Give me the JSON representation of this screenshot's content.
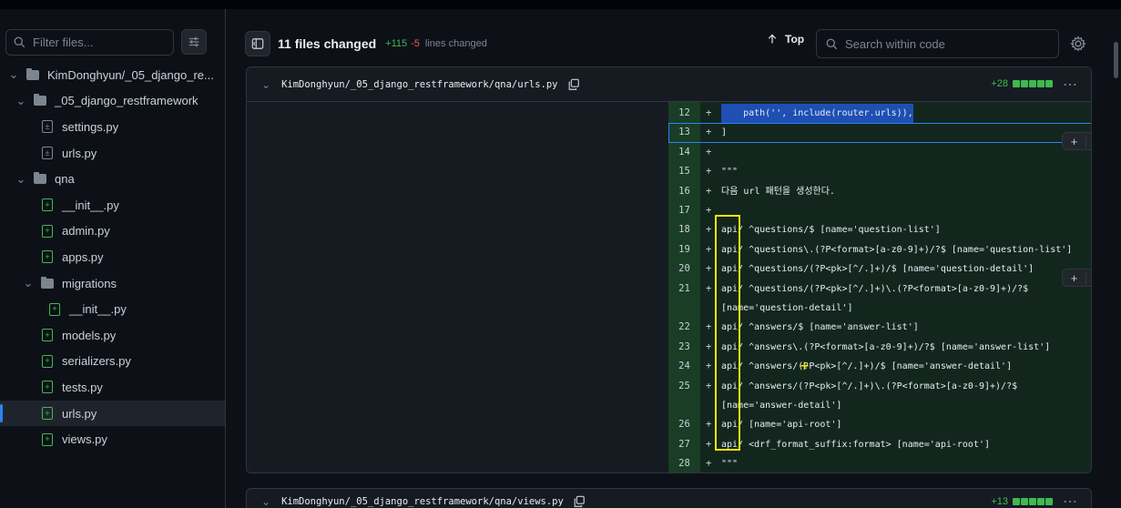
{
  "sidebar": {
    "filter_placeholder": "Filter files...",
    "tree": [
      {
        "label": "KimDonghyun/_05_django_re...",
        "type": "folder",
        "depth": 0
      },
      {
        "label": "_05_django_restframework",
        "type": "folder",
        "depth": 1
      },
      {
        "label": "settings.py",
        "type": "file-modified",
        "depth": 2
      },
      {
        "label": "urls.py",
        "type": "file-modified",
        "depth": 2
      },
      {
        "label": "qna",
        "type": "folder",
        "depth": 1
      },
      {
        "label": "__init__.py",
        "type": "file-added",
        "depth": 2
      },
      {
        "label": "admin.py",
        "type": "file-added",
        "depth": 2
      },
      {
        "label": "apps.py",
        "type": "file-added",
        "depth": 2
      },
      {
        "label": "migrations",
        "type": "folder",
        "depth": 2
      },
      {
        "label": "__init__.py",
        "type": "file-added",
        "depth": 3
      },
      {
        "label": "models.py",
        "type": "file-added",
        "depth": 2
      },
      {
        "label": "serializers.py",
        "type": "file-added",
        "depth": 2
      },
      {
        "label": "tests.py",
        "type": "file-added",
        "depth": 2
      },
      {
        "label": "urls.py",
        "type": "file-added",
        "depth": 2,
        "active": true
      },
      {
        "label": "views.py",
        "type": "file-added",
        "depth": 2
      }
    ]
  },
  "header": {
    "files_changed": "11 files changed",
    "additions": "+115",
    "deletions": "-5",
    "lines_changed": "lines changed",
    "top_label": "Top",
    "search_placeholder": "Search within code"
  },
  "file1": {
    "path": "KimDonghyun/_05_django_restframework/qna/urls.py",
    "additions": "+28",
    "lines": [
      {
        "num": "12",
        "plus": "+",
        "code": "    path('', include(router.urls)),"
      },
      {
        "num": "13",
        "plus": "+",
        "code": "]"
      },
      {
        "num": "14",
        "plus": "+",
        "code": ""
      },
      {
        "num": "15",
        "plus": "+",
        "code": "\"\"\""
      },
      {
        "num": "16",
        "plus": "+",
        "code": "다음 url 패턴을 생성한다."
      },
      {
        "num": "17",
        "plus": "+",
        "code": ""
      },
      {
        "num": "18",
        "plus": "+",
        "code": "api/ ^questions/$ [name='question-list']"
      },
      {
        "num": "19",
        "plus": "+",
        "code": "api/ ^questions\\.(?P<format>[a-z0-9]+)/?$ [name='question-list']"
      },
      {
        "num": "20",
        "plus": "+",
        "code": "api/ ^questions/(?P<pk>[^/.]+)/$ [name='question-detail']"
      },
      {
        "num": "21",
        "plus": "+",
        "code": "api/ ^questions/(?P<pk>[^/.]+)\\.(?P<format>[a-z0-9]+)/?$"
      },
      {
        "num": "",
        "plus": "",
        "code": "[name='question-detail']"
      },
      {
        "num": "22",
        "plus": "+",
        "code": "api/ ^answers/$ [name='answer-list']"
      },
      {
        "num": "23",
        "plus": "+",
        "code": "api/ ^answers\\.(?P<format>[a-z0-9]+)/?$ [name='answer-list']"
      },
      {
        "num": "24",
        "plus": "+",
        "code": "api/ ^answers/(?P<pk>[^/.]+)/$ [name='answer-detail']"
      },
      {
        "num": "25",
        "plus": "+",
        "code": "api/ ^answers/(?P<pk>[^/.]+)\\.(?P<format>[a-z0-9]+)/?$"
      },
      {
        "num": "",
        "plus": "",
        "code": "[name='answer-detail']"
      },
      {
        "num": "26",
        "plus": "+",
        "code": "api/ [name='api-root']"
      },
      {
        "num": "27",
        "plus": "+",
        "code": "api/ <drf_format_suffix:format> [name='api-root']"
      },
      {
        "num": "28",
        "plus": "+",
        "code": "\"\"\""
      }
    ]
  },
  "file2": {
    "path": "KimDonghyun/_05_django_restframework/qna/views.py",
    "additions": "+13"
  },
  "hover_plus": "+",
  "cursor_glyph": "+",
  "colors": {
    "accent": "#2f81f7",
    "added": "#3fb950",
    "deleted": "#f85149",
    "highlight_box": "#f2e600"
  }
}
